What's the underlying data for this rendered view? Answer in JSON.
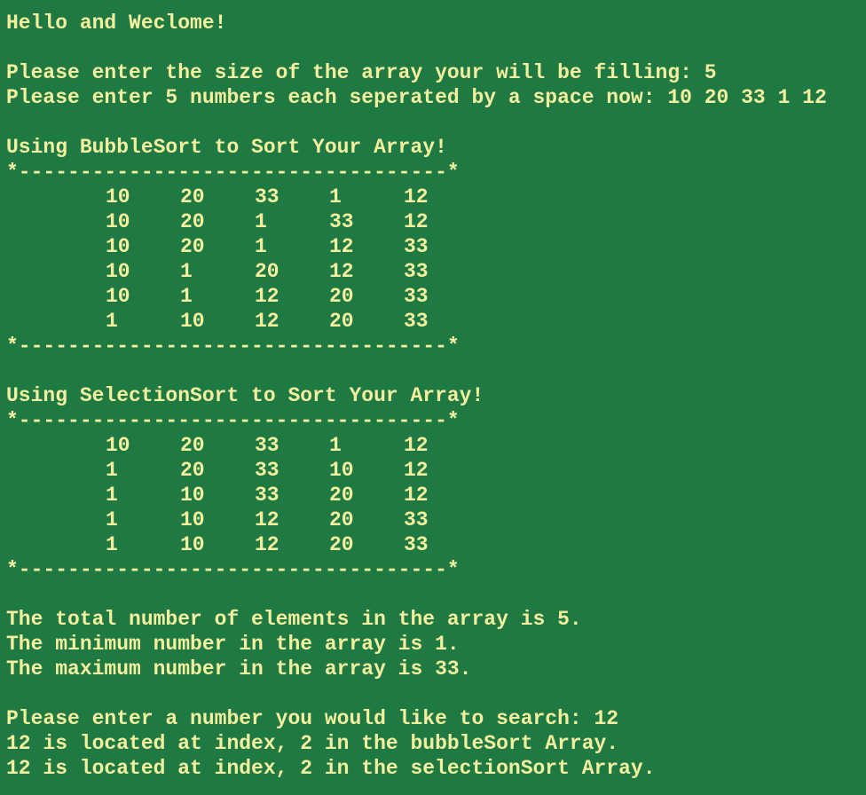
{
  "terminal": {
    "greeting": "Hello and Weclome!",
    "prompt_size": "Please enter the size of the array your will be filling: 5",
    "prompt_numbers": "Please enter 5 numbers each seperated by a space now: 10 20 33 1 12",
    "bubble": {
      "heading": "Using BubbleSort to Sort Your Array!",
      "border_top": "*-----------------------------------*",
      "rows": [
        [
          "10",
          "20",
          "33",
          "1",
          "12"
        ],
        [
          "10",
          "20",
          "1",
          "33",
          "12"
        ],
        [
          "10",
          "20",
          "1",
          "12",
          "33"
        ],
        [
          "10",
          "1",
          "20",
          "12",
          "33"
        ],
        [
          "10",
          "1",
          "12",
          "20",
          "33"
        ],
        [
          "1",
          "10",
          "12",
          "20",
          "33"
        ]
      ],
      "border_bottom": "*-----------------------------------*"
    },
    "selection": {
      "heading": "Using SelectionSort to Sort Your Array!",
      "border_top": "*-----------------------------------*",
      "rows": [
        [
          "10",
          "20",
          "33",
          "1",
          "12"
        ],
        [
          "1",
          "20",
          "33",
          "10",
          "12"
        ],
        [
          "1",
          "10",
          "33",
          "20",
          "12"
        ],
        [
          "1",
          "10",
          "12",
          "20",
          "33"
        ],
        [
          "1",
          "10",
          "12",
          "20",
          "33"
        ]
      ],
      "border_bottom": "*-----------------------------------*"
    },
    "stats": {
      "total": "The total number of elements in the array is 5.",
      "min": "The minimum number in the array is 1.",
      "max": "The maximum number in the array is 33."
    },
    "search": {
      "prompt": "Please enter a number you would like to search: 12",
      "bubble_result": "12 is located at index, 2 in the bubbleSort Array.",
      "selection_result": "12 is located at index, 2 in the selectionSort Array."
    }
  }
}
